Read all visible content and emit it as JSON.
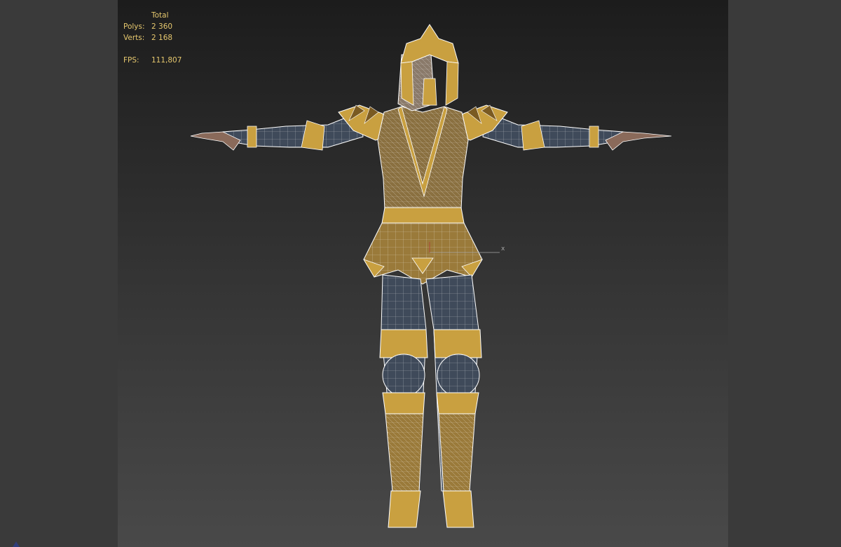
{
  "stats": {
    "header": "Total",
    "polys_label": "Polys:",
    "polys_value": "2 360",
    "verts_label": "Verts:",
    "verts_value": "2 168",
    "fps_label": "FPS:",
    "fps_value": "111,807"
  },
  "axis": {
    "x_label": "x"
  },
  "colors": {
    "stats_text": "#e6c86e",
    "armor_gold": "#c9a040",
    "armor_dark": "#7a5a22",
    "cloth": "#3f4a5a",
    "wire": "#ffffff",
    "viewport_top": "#1c1c1c",
    "viewport_bottom": "#494949"
  }
}
